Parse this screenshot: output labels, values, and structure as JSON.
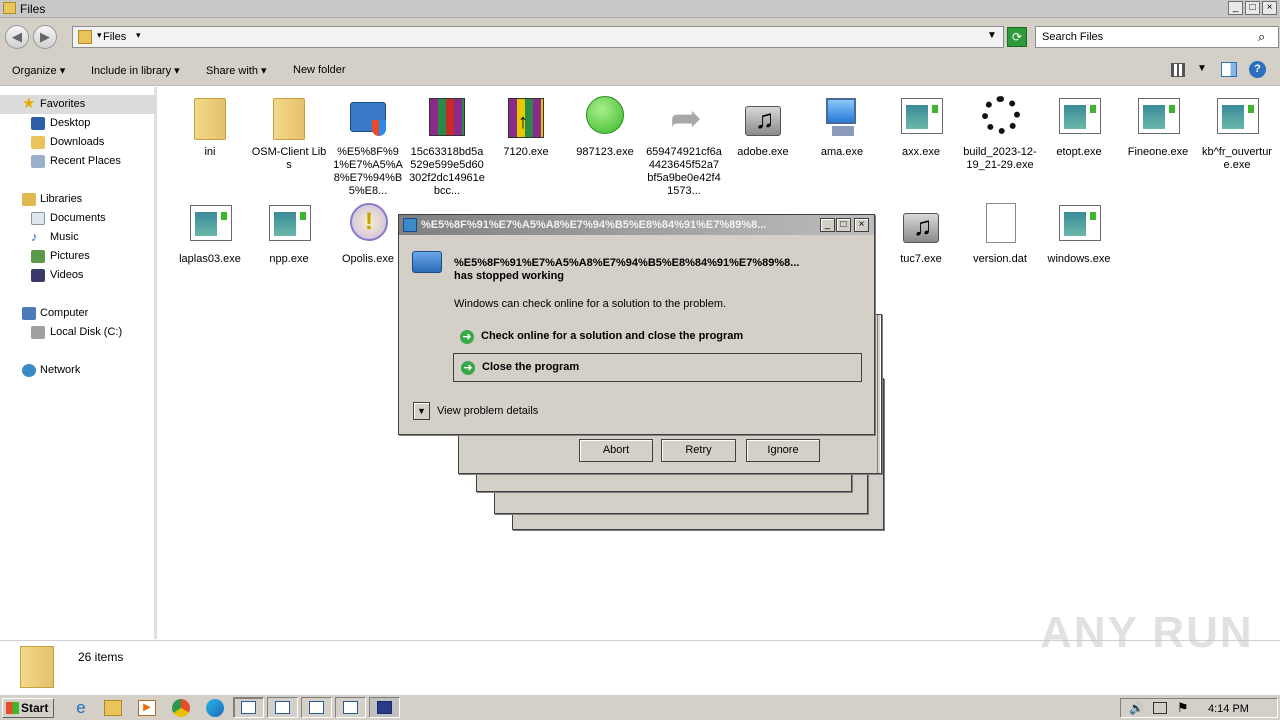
{
  "window": {
    "title": "Files",
    "minimize": "_",
    "maximize": "□",
    "close": "×"
  },
  "addressbar": {
    "crumb": "Files",
    "back": "◀",
    "forward": "▶",
    "search_placeholder": "Search Files"
  },
  "toolbar": {
    "organize": "Organize",
    "include_in_library": "Include in library",
    "share_with": "Share with",
    "new_folder": "New folder"
  },
  "nav": {
    "favorites": "Favorites",
    "desktop": "Desktop",
    "downloads": "Downloads",
    "recent_places": "Recent Places",
    "libraries": "Libraries",
    "documents": "Documents",
    "music": "Music",
    "pictures": "Pictures",
    "videos": "Videos",
    "computer": "Computer",
    "local_disk": "Local Disk (C:)",
    "network": "Network"
  },
  "files": [
    {
      "name": "ini",
      "icon": "folder-icon"
    },
    {
      "name": "OSM-Client Libs",
      "icon": "folder-icon"
    },
    {
      "name": "%E5%8F%91%E7%A5%A8%E7%94%B5%E8...",
      "icon": "folder-shield-app-icon"
    },
    {
      "name": "15c63318bd5a529e599e5d60302f2dc14961ebcc...",
      "icon": "winrar-archive-icon"
    },
    {
      "name": "7120.exe",
      "icon": "winrar-sfx-icon"
    },
    {
      "name": "987123.exe",
      "icon": "green-circle-icon"
    },
    {
      "name": "659474921cf6a4423645f52a7bf5a9be0e42f41573...",
      "icon": "shortcut-arrow-icon"
    },
    {
      "name": "adobe.exe",
      "icon": "music-drive-icon"
    },
    {
      "name": "ama.exe",
      "icon": "computer-icon"
    },
    {
      "name": "axx.exe",
      "icon": "app-window-icon"
    },
    {
      "name": "build_2023-12-19_21-29.exe",
      "icon": "loading-spinner-icon"
    },
    {
      "name": "etopt.exe",
      "icon": "app-window-icon"
    },
    {
      "name": "Fineone.exe",
      "icon": "app-window-icon"
    },
    {
      "name": "kb^fr_ouverture.exe",
      "icon": "app-window-icon"
    },
    {
      "name": "laplas03.exe",
      "icon": "app-window-icon"
    },
    {
      "name": "npp.exe",
      "icon": "app-window-icon"
    },
    {
      "name": "Opolis.exe",
      "icon": "warning-icon"
    },
    {
      "name": "tuc7.exe",
      "icon": "music-drive-icon"
    },
    {
      "name": "version.dat",
      "icon": "blank-file-icon"
    },
    {
      "name": "windows.exe",
      "icon": "app-window-icon"
    }
  ],
  "status": {
    "count": "26 items"
  },
  "error_dialog": {
    "title": "%E5%8F%91%E7%A5%A8%E7%94%B5%E8%84%91%E7%89%8...",
    "app_name": "%E5%8F%91%E7%A5%A8%E7%94%B5%E8%84%91%E7%89%8...",
    "stopped": "has stopped working",
    "message": "Windows can check online for a solution to the problem.",
    "option_check": "Check online for a solution and close the program",
    "option_close": "Close the program",
    "details": "View problem details"
  },
  "abort_dialog": {
    "abort": "Abort",
    "retry": "Retry",
    "ignore": "Ignore"
  },
  "taskbar": {
    "start": "Start",
    "clock": "4:14 PM"
  },
  "watermark": "ANY RUN",
  "colors": {
    "chrome": "#d4d0c8",
    "title_gradient_start": "#808080",
    "accent_green": "#3aa84a"
  }
}
